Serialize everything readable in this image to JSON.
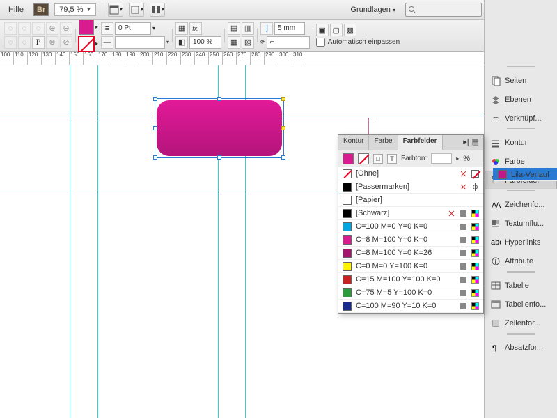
{
  "menubar": {
    "help": "Hilfe",
    "bridge_badge": "Br",
    "zoom_value": "79,5 %",
    "workspace_label": "Grundlagen",
    "search_placeholder": ""
  },
  "controlbar": {
    "stroke_weight": "0 Pt",
    "opacity": "100 %",
    "inset": "5 mm",
    "autofit_label": "Automatisch einpassen"
  },
  "ruler_ticks": [
    "100",
    "110",
    "120",
    "130",
    "140",
    "150",
    "160",
    "170",
    "180",
    "190",
    "200",
    "210",
    "220",
    "230",
    "240",
    "250",
    "260",
    "270",
    "280",
    "290",
    "300",
    "310"
  ],
  "right_panels": {
    "group1": [
      {
        "label": "Seiten",
        "icon": "pages"
      },
      {
        "label": "Ebenen",
        "icon": "layers"
      },
      {
        "label": "Verknüpf...",
        "icon": "links"
      }
    ],
    "group2": [
      {
        "label": "Kontur",
        "icon": "stroke"
      },
      {
        "label": "Farbe",
        "icon": "color"
      },
      {
        "label": "Farbfelder",
        "icon": "swatches",
        "active": true
      }
    ],
    "group3": [
      {
        "label": "Zeichenfo...",
        "icon": "charstyle"
      },
      {
        "label": "Textumflu...",
        "icon": "textwrap"
      },
      {
        "label": "Hyperlinks",
        "icon": "hyperlink"
      },
      {
        "label": "Attribute",
        "icon": "attributes"
      }
    ],
    "group4": [
      {
        "label": "Tabelle",
        "icon": "table"
      },
      {
        "label": "Tabellenfo...",
        "icon": "tablestyle"
      },
      {
        "label": "Zellenfor...",
        "icon": "cellstyle"
      }
    ],
    "group5": [
      {
        "label": "Absatzfor...",
        "icon": "parastyle"
      }
    ]
  },
  "swatches_panel": {
    "tabs": [
      "Kontur",
      "Farbe",
      "Farbfelder"
    ],
    "active_tab": 2,
    "tint_label": "Farbton:",
    "tint_unit": "%",
    "rows": [
      {
        "name": "[Ohne]",
        "color": "none",
        "lock": true,
        "noedit": true
      },
      {
        "name": "[Passermarken]",
        "color": "#000000",
        "reg": true,
        "lock": true
      },
      {
        "name": "[Papier]",
        "color": "#ffffff"
      },
      {
        "name": "[Schwarz]",
        "color": "#000000",
        "lock": true,
        "cmyk": true
      },
      {
        "name": "C=100 M=0 Y=0 K=0",
        "color": "#00a7e1",
        "cmyk": true
      },
      {
        "name": "C=8 M=100 Y=0 K=0",
        "color": "#d81b8f",
        "cmyk": true
      },
      {
        "name": "C=8 M=100 Y=0 K=26",
        "color": "#a5156d",
        "cmyk": true
      },
      {
        "name": "C=0 M=0 Y=100 K=0",
        "color": "#fff400",
        "cmyk": true
      },
      {
        "name": "C=15 M=100 Y=100 K=0",
        "color": "#c92020",
        "cmyk": true
      },
      {
        "name": "C=75 M=5 Y=100 K=0",
        "color": "#2c9b3a",
        "cmyk": true
      },
      {
        "name": "C=100 M=90 Y=10 K=0",
        "color": "#1a2b8e",
        "cmyk": true
      },
      {
        "name": "Lila-Verlauf",
        "color": "#c01886",
        "selected": true,
        "gradient": true
      }
    ]
  }
}
